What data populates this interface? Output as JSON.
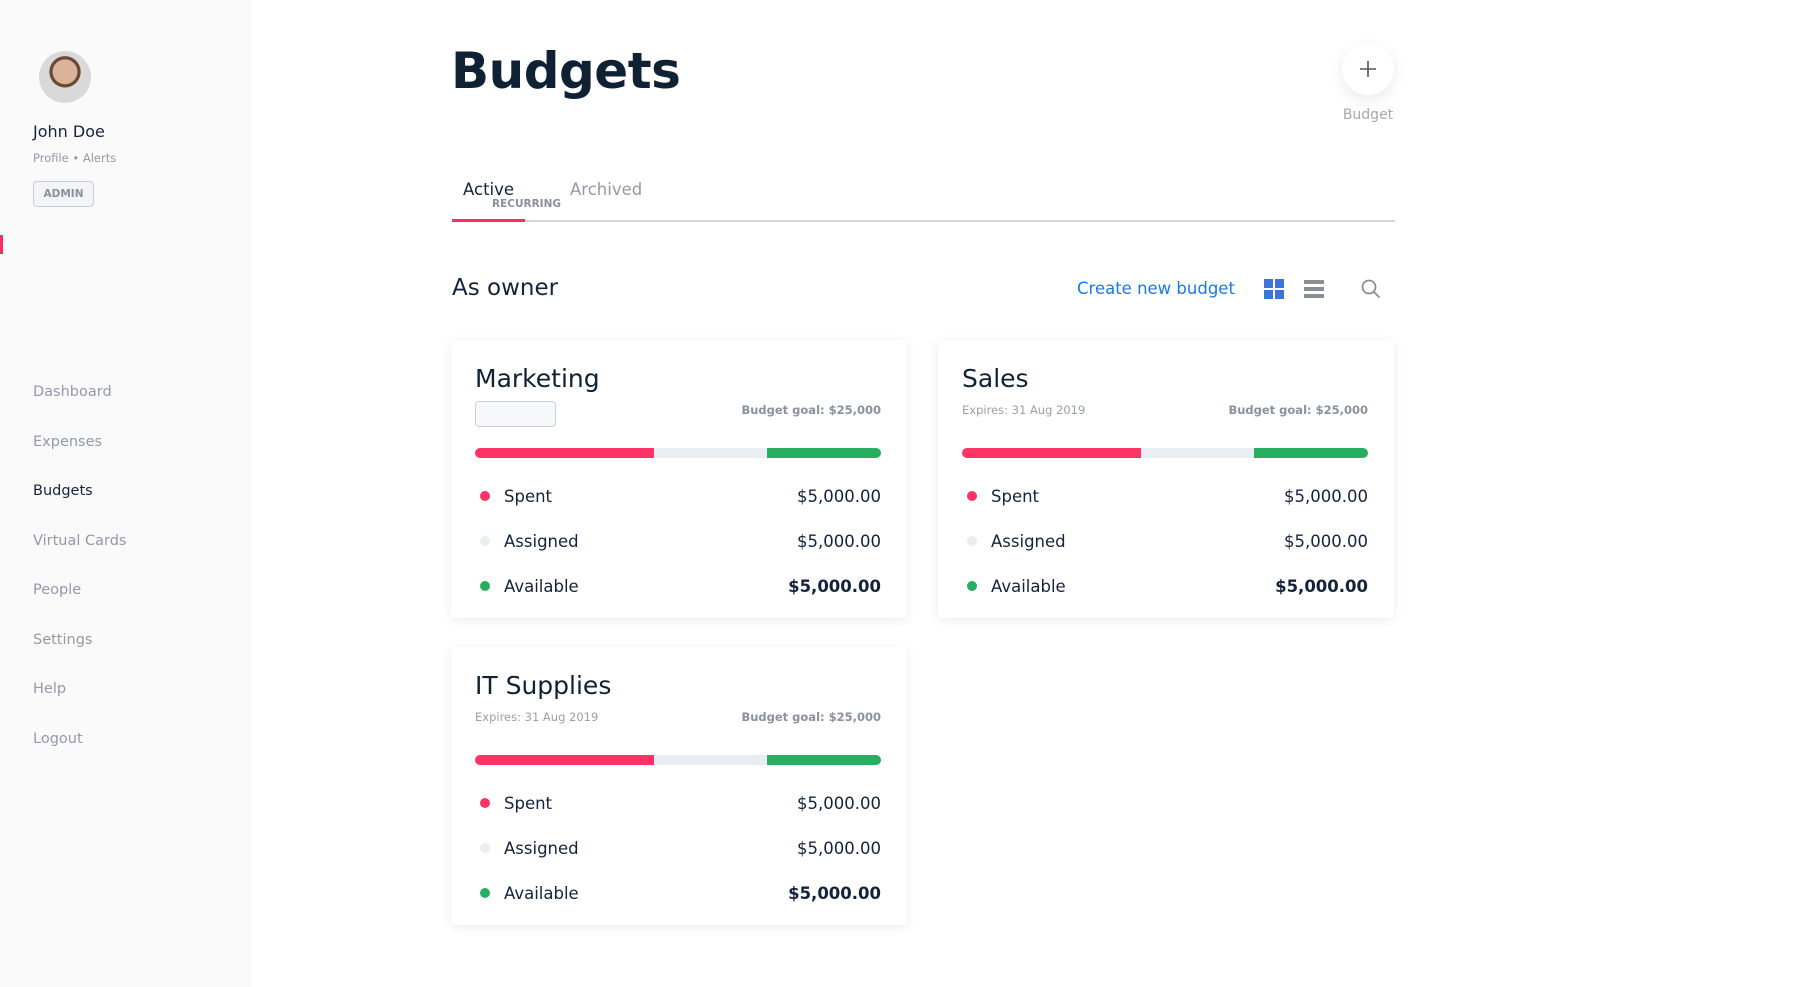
{
  "sidebar": {
    "user": {
      "name": "John Doe",
      "links": "Profile • Alerts",
      "role_badge": "ADMIN"
    },
    "nav": [
      {
        "label": "Dashboard",
        "active": false
      },
      {
        "label": "Expenses",
        "active": false
      },
      {
        "label": "Budgets",
        "active": true
      },
      {
        "label": "Virtual Cards",
        "active": false
      },
      {
        "label": "People",
        "active": false
      },
      {
        "label": "Settings",
        "active": false
      },
      {
        "label": "Help",
        "active": false
      },
      {
        "label": "Logout",
        "active": false
      }
    ]
  },
  "header": {
    "title": "Budgets",
    "add_button_label": "Budget",
    "add_icon": "plus-icon"
  },
  "tabs": [
    {
      "label": "Active",
      "sublabel": "RECURRING",
      "active": true
    },
    {
      "label": "Archived",
      "active": false
    }
  ],
  "section": {
    "title": "As owner",
    "create_label": "Create new budget",
    "icons": [
      "grid-view-icon",
      "list-view-icon",
      "search-icon"
    ]
  },
  "colors": {
    "accent": "#ff2d64",
    "spent": "#ff3366",
    "assigned": "#e9eef2",
    "available": "#27ae60",
    "link": "#1a7ae0",
    "grid_active": "#3d74dc",
    "icon_gray": "#8a8f96"
  },
  "budgets": [
    {
      "name": "Marketing",
      "expires": "",
      "goal": "Budget goal: $25,000",
      "spent_pct": 44,
      "assigned_pct": 28,
      "available_pct": 28,
      "rows": [
        {
          "label": "Spent",
          "value": "$5,000.00"
        },
        {
          "label": "Assigned",
          "value": "$5,000.00"
        },
        {
          "label": "Available",
          "value": "$5,000.00"
        }
      ]
    },
    {
      "name": "Sales",
      "expires": "Expires: 31 Aug 2019",
      "goal": "Budget goal: $25,000",
      "spent_pct": 44,
      "assigned_pct": 28,
      "available_pct": 28,
      "rows": [
        {
          "label": "Spent",
          "value": "$5,000.00"
        },
        {
          "label": "Assigned",
          "value": "$5,000.00"
        },
        {
          "label": "Available",
          "value": "$5,000.00"
        }
      ]
    },
    {
      "name": "IT Supplies",
      "expires": "Expires: 31 Aug 2019",
      "goal": "Budget goal: $25,000",
      "spent_pct": 44,
      "assigned_pct": 28,
      "available_pct": 28,
      "rows": [
        {
          "label": "Spent",
          "value": "$5,000.00"
        },
        {
          "label": "Assigned",
          "value": "$5,000.00"
        },
        {
          "label": "Available",
          "value": "$5,000.00"
        }
      ]
    }
  ]
}
